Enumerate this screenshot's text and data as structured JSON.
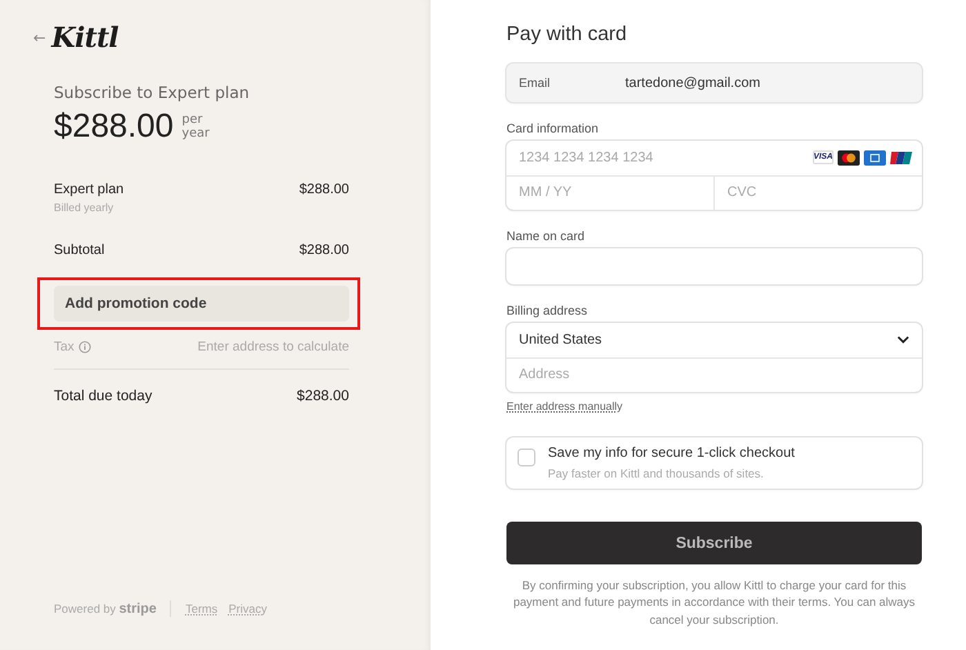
{
  "summary": {
    "back": "←",
    "logo": "Kittl",
    "heading": "Subscribe to Expert plan",
    "price": "$288.00",
    "period": "per year",
    "lines": [
      {
        "kind": "item",
        "label": "Expert plan",
        "sub": "Billed yearly",
        "amount": "$288.00"
      },
      {
        "kind": "subtotal",
        "label": "Subtotal",
        "amount": "$288.00"
      }
    ],
    "promo": {
      "label": "Add promotion code",
      "highlighted": true
    },
    "tax": {
      "label": "Tax",
      "note": "Enter address to calculate"
    },
    "total": {
      "label": "Total due today",
      "amount": "$288.00"
    },
    "footer": {
      "powered": "Powered by",
      "brand": "stripe",
      "links": [
        "Terms",
        "Privacy"
      ]
    }
  },
  "form": {
    "title": "Pay with card",
    "email": {
      "label": "Email",
      "value": "tartedone@gmail.com"
    },
    "card": {
      "label": "Card information",
      "number_placeholder": "1234 1234 1234 1234",
      "visa": "VISA",
      "expiry_placeholder": "MM / YY",
      "cvc_placeholder": "CVC"
    },
    "name": {
      "label": "Name on card"
    },
    "billing": {
      "label": "Billing address",
      "country": "United States",
      "address_placeholder": "Address",
      "manual_link": "Enter address manually"
    },
    "save": {
      "checked": false,
      "label": "Save my info for secure 1-click checkout",
      "hint": "Pay faster on Kittl and thousands of sites."
    },
    "submit": "Subscribe",
    "legal": "By confirming your subscription, you allow Kittl to charge your card for this payment and future payments in accordance with their terms. You can always cancel your subscription."
  }
}
